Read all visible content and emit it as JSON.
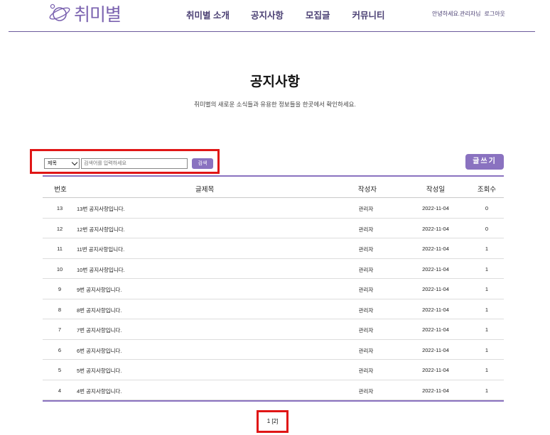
{
  "header": {
    "logo_text": "취미별",
    "nav": [
      "취미별 소개",
      "공지사항",
      "모집글",
      "커뮤니티"
    ],
    "greeting": "안녕하세요.관리자님",
    "logout": "로그아웃"
  },
  "page": {
    "title": "공지사항",
    "subtitle": "취미별의 새로운 소식들과 유용한 정보들을 한곳에서 확인하세요."
  },
  "search": {
    "select_value": "제목",
    "placeholder": "검색어를 입력하세요",
    "button": "검색"
  },
  "write_button": "글쓰기",
  "table": {
    "headers": [
      "번호",
      "글제목",
      "작성자",
      "작성일",
      "조회수"
    ],
    "rows": [
      {
        "no": "13",
        "title": "13번 공지사항입니다.",
        "writer": "관리자",
        "date": "2022-11-04",
        "views": "0"
      },
      {
        "no": "12",
        "title": "12번 공지사항입니다.",
        "writer": "관리자",
        "date": "2022-11-04",
        "views": "0"
      },
      {
        "no": "11",
        "title": "11번 공지사항입니다.",
        "writer": "관리자",
        "date": "2022-11-04",
        "views": "1"
      },
      {
        "no": "10",
        "title": "10번 공지사항입니다.",
        "writer": "관리자",
        "date": "2022-11-04",
        "views": "1"
      },
      {
        "no": "9",
        "title": "9번 공지사항입니다.",
        "writer": "관리자",
        "date": "2022-11-04",
        "views": "1"
      },
      {
        "no": "8",
        "title": "8번 공지사항입니다.",
        "writer": "관리자",
        "date": "2022-11-04",
        "views": "1"
      },
      {
        "no": "7",
        "title": "7번 공지사항입니다.",
        "writer": "관리자",
        "date": "2022-11-04",
        "views": "1"
      },
      {
        "no": "6",
        "title": "6번 공지사항입니다.",
        "writer": "관리자",
        "date": "2022-11-04",
        "views": "1"
      },
      {
        "no": "5",
        "title": "5번 공지사항입니다.",
        "writer": "관리자",
        "date": "2022-11-04",
        "views": "1"
      },
      {
        "no": "4",
        "title": "4번 공지사항입니다.",
        "writer": "관리자",
        "date": "2022-11-04",
        "views": "1"
      }
    ]
  },
  "paging": {
    "current": "1",
    "other": "[2]"
  },
  "colors": {
    "accent": "#8a72c0",
    "nav_text": "#4a3f73",
    "highlight_box": "#e01616"
  }
}
